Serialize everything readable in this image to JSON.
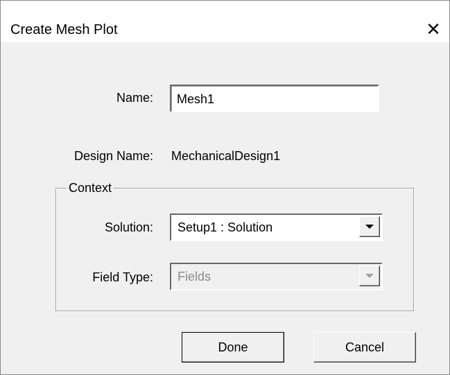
{
  "window": {
    "title": "Create Mesh Plot",
    "close_glyph": "✕"
  },
  "form": {
    "name_label": "Name:",
    "name_value": "Mesh1",
    "design_name_label": "Design Name:",
    "design_name_value": "MechanicalDesign1"
  },
  "context": {
    "legend": "Context",
    "solution_label": "Solution:",
    "solution_value": "Setup1 : Solution",
    "field_type_label": "Field Type:",
    "field_type_value": "Fields"
  },
  "buttons": {
    "done_label": "Done",
    "cancel_label": "Cancel"
  },
  "icons": {
    "close": "close-icon",
    "dropdown": "chevron-down-icon"
  }
}
